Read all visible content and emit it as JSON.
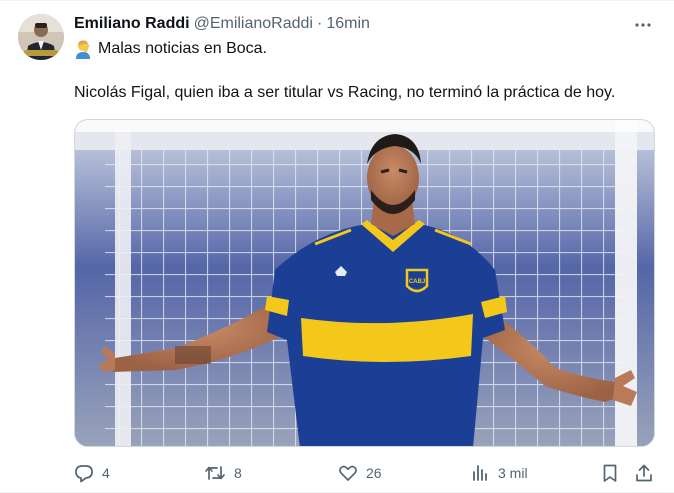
{
  "tweet": {
    "display_name": "Emiliano Raddi",
    "handle": "@EmilianoRaddi",
    "separator": "·",
    "time": "16min",
    "line1_emoji": "person-facepalming-emoji",
    "line1_text": "Malas noticias en Boca.",
    "line2_text": "Nicolás Figal, quien iba a ser titular vs Racing, no terminó la práctica de hoy.",
    "media": {
      "description_icon": "photo-boca-player",
      "badge_text": "CABJ"
    }
  },
  "actions": {
    "reply_count": "4",
    "retweet_count": "8",
    "like_count": "26",
    "views_count": "3 mil"
  },
  "colors": {
    "text_primary": "#0f1419",
    "text_secondary": "#536471",
    "boca_blue": "#1b3f95",
    "boca_yellow": "#f3c81b"
  }
}
